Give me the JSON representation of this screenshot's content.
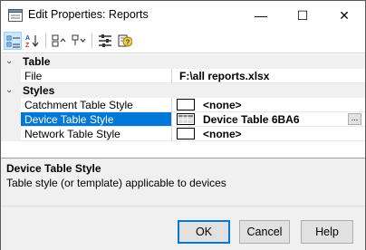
{
  "window": {
    "title": "Edit Properties: Reports",
    "minimize_glyph": "—",
    "maximize_glyph": "☐",
    "close_glyph": "✕"
  },
  "toolbar": {
    "buttons": [
      {
        "name": "categorized-view",
        "icon": "categorized-icon",
        "active": true
      },
      {
        "name": "alphabetical-sort",
        "icon": "sort-az-icon",
        "active": false
      },
      {
        "name": "expand-categories",
        "icon": "expand-icon",
        "active": false
      },
      {
        "name": "collapse-categories",
        "icon": "collapse-icon",
        "active": false
      },
      {
        "name": "property-pages",
        "icon": "property-pages-icon",
        "active": false
      },
      {
        "name": "help-cursor",
        "icon": "help-icon",
        "active": false
      }
    ]
  },
  "grid": {
    "categories": [
      {
        "label": "Table",
        "toggle": "⌄",
        "properties": [
          {
            "name": "File",
            "value": "F:\\all reports.xlsx"
          }
        ]
      },
      {
        "label": "Styles",
        "toggle": "⌄",
        "properties": [
          {
            "name": "Catchment Table Style",
            "value": "<none>"
          },
          {
            "name": "Device Table Style",
            "value": "Device Table 6BA6",
            "selected": true,
            "button": "..."
          },
          {
            "name": "Network Table Style",
            "value": "<none>"
          }
        ]
      }
    ]
  },
  "description": {
    "title": "Device Table Style",
    "text": "Table style (or template) applicable to devices"
  },
  "footer": {
    "ok_label": "OK",
    "cancel_label": "Cancel",
    "help_label": "Help"
  },
  "colors": {
    "selection": "#0078d7",
    "toolbar_active": "#cce8ff",
    "panel_bg": "#f0f0f0"
  }
}
